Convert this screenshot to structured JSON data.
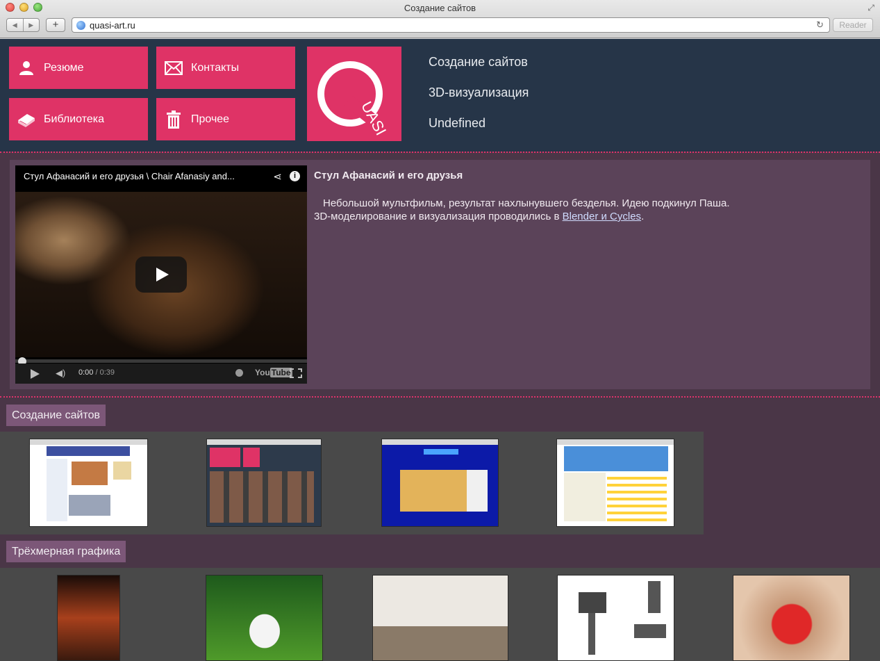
{
  "browser": {
    "window_title": "Создание сайтов",
    "address": "quasi-art.ru",
    "reader_label": "Reader",
    "new_tab_label": "+"
  },
  "menu": {
    "items": [
      {
        "label": "Резюме",
        "icon": "person-icon"
      },
      {
        "label": "Контакты",
        "icon": "envelope-icon"
      },
      {
        "label": "Библиотека",
        "icon": "book-icon"
      },
      {
        "label": "Прочее",
        "icon": "trash-icon"
      }
    ]
  },
  "logo": {
    "text": "UASI",
    "icon": "quasi-logo"
  },
  "header_links": [
    "Создание сайтов",
    "3D-визуализация",
    "Undefined"
  ],
  "feature": {
    "video_title": "Стул Афанасий и его друзья \\ Chair Afanasiy and...",
    "time_current": "0:00",
    "time_total": "/ 0:39",
    "youtube_you": "You",
    "youtube_tube": "Tube",
    "title": "Стул Афанасий и его друзья",
    "body_line1": "Небольшой мультфильм, результат нахлынувшего безделья. Идею подкинул Паша.",
    "body_line2_pre": "3D-моделирование и визуализация проводились в ",
    "body_link": "Blender и Cycles",
    "body_line2_post": "."
  },
  "sections": {
    "sites_label": "Создание сайтов",
    "graphics_label": "Трёхмерная графика"
  },
  "colors": {
    "accent": "#df3366",
    "header_bg": "#263548",
    "page_bg": "#4a3647",
    "feature_bg": "#5b4359",
    "section_label_bg": "#7c5778"
  }
}
